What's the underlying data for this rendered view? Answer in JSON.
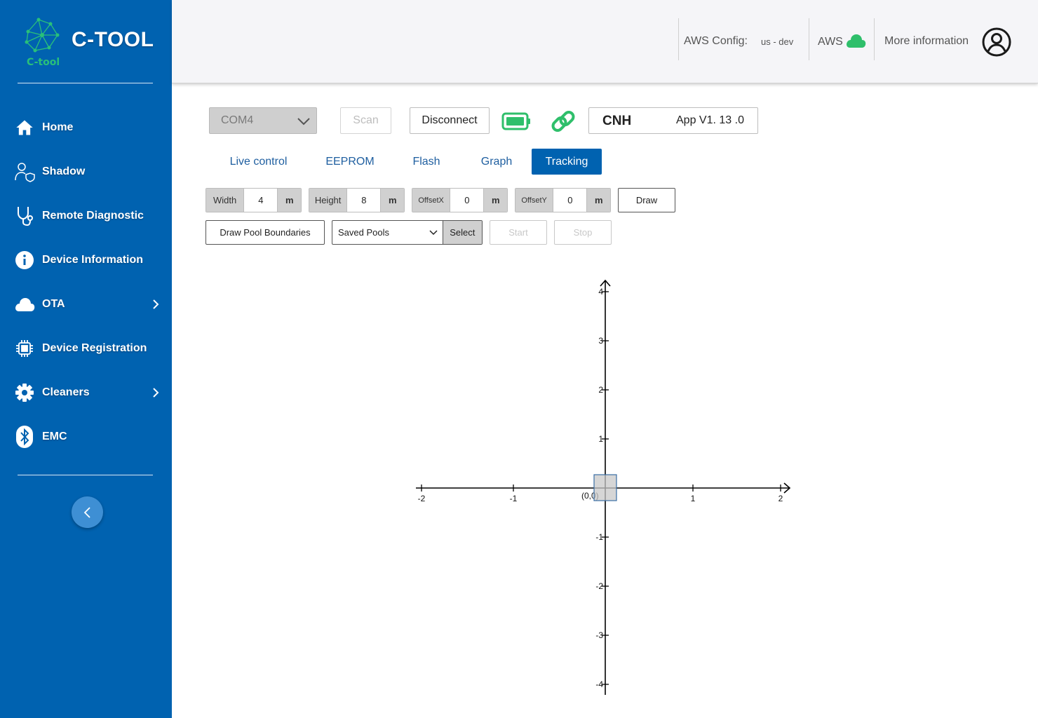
{
  "app": {
    "title": "C-TOOL",
    "subtitle": "C-tool",
    "colors": {
      "sidebar": "#0062b0",
      "accent_green": "#2fbf6b",
      "logo_green": "#29c07a"
    }
  },
  "sidebar": {
    "items": [
      {
        "label": "Home",
        "icon": "home-icon"
      },
      {
        "label": "Shadow",
        "icon": "user-shield-icon"
      },
      {
        "label": "Remote Diagnostic",
        "icon": "stethoscope-icon"
      },
      {
        "label": "Device Information",
        "icon": "info-icon"
      },
      {
        "label": "OTA",
        "icon": "cloud-icon",
        "has_submenu": true
      },
      {
        "label": "Device Registration",
        "icon": "chip-icon"
      },
      {
        "label": "Cleaners",
        "icon": "gear-icon",
        "has_submenu": true
      },
      {
        "label": "EMC",
        "icon": "bluetooth-icon"
      }
    ]
  },
  "header": {
    "aws_config_label": "AWS Config:",
    "aws_config_value": "us - dev",
    "aws_label": "AWS",
    "more_info_label": "More information"
  },
  "toolbar": {
    "port_value": "COM4",
    "scan_label": "Scan",
    "disconnect_label": "Disconnect",
    "device_name": "CNH",
    "app_version": "App V1. 13 .0"
  },
  "tabs": [
    {
      "label": "Live control",
      "active": false
    },
    {
      "label": "EEPROM",
      "active": false
    },
    {
      "label": "Flash",
      "active": false
    },
    {
      "label": "Graph",
      "active": false
    },
    {
      "label": "Tracking",
      "active": true
    }
  ],
  "tracking": {
    "width": {
      "label": "Width",
      "value": "4",
      "unit": "m"
    },
    "height": {
      "label": "Height",
      "value": "8",
      "unit": "m"
    },
    "offset_x": {
      "label": "OffsetX",
      "value": "0",
      "unit": "m"
    },
    "offset_y": {
      "label": "OffsetY",
      "value": "0",
      "unit": "m"
    },
    "draw_label": "Draw",
    "draw_pool_label": "Draw Pool Boundaries",
    "saved_pools_value": "Saved Pools",
    "select_label": "Select",
    "start_label": "Start",
    "stop_label": "Stop"
  },
  "chart_data": {
    "type": "scatter",
    "title": "",
    "xlabel": "",
    "ylabel": "",
    "xlim": [
      -2,
      2
    ],
    "ylim": [
      -4,
      4
    ],
    "x_ticks": [
      "-2",
      "-1",
      "1",
      "2"
    ],
    "y_ticks": [
      "4",
      "3",
      "2",
      "1",
      "-1",
      "-2",
      "-3",
      "-4"
    ],
    "origin_label": "(0,0)",
    "grid": false,
    "marker": {
      "x": 0,
      "y": 0,
      "shape": "square"
    }
  }
}
